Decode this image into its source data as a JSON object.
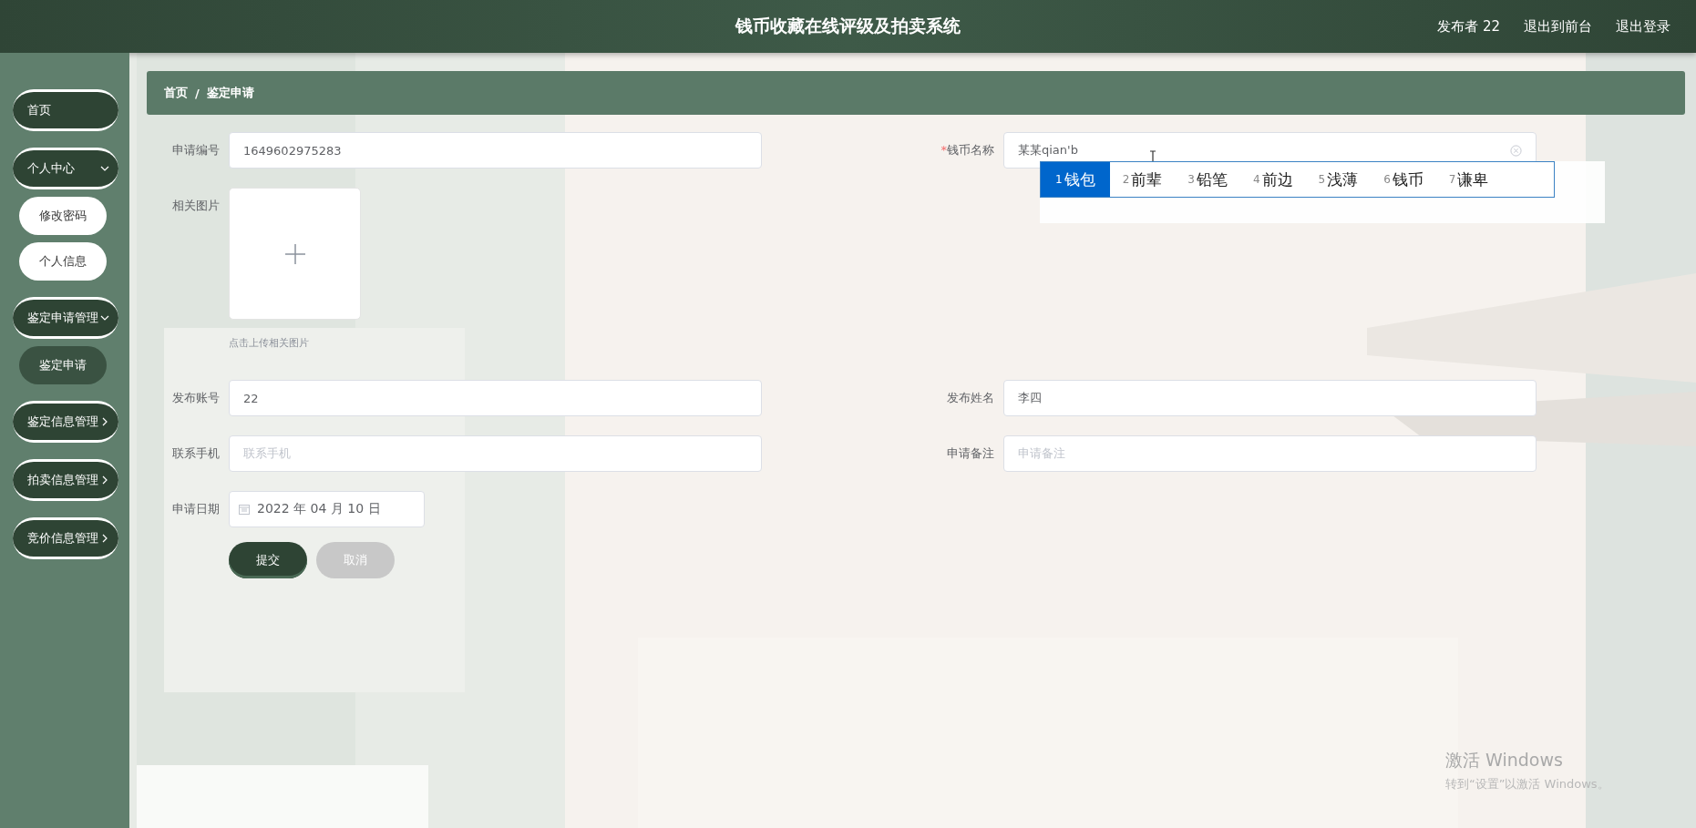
{
  "header": {
    "title": "钱币收藏在线评级及拍卖系统",
    "links": [
      "发布者 22",
      "退出到前台",
      "退出登录"
    ]
  },
  "sidebar": {
    "items": [
      {
        "label": "首页",
        "kind": "link"
      },
      {
        "label": "个人中心",
        "kind": "group",
        "expanded": true,
        "children": [
          {
            "label": "修改密码",
            "selected": false
          },
          {
            "label": "个人信息",
            "selected": false
          }
        ]
      },
      {
        "label": "鉴定申请管理",
        "kind": "group",
        "expanded": true,
        "children": [
          {
            "label": "鉴定申请",
            "selected": true
          }
        ]
      },
      {
        "label": "鉴定信息管理",
        "kind": "group",
        "expanded": false
      },
      {
        "label": "拍卖信息管理",
        "kind": "group",
        "expanded": false
      },
      {
        "label": "竞价信息管理",
        "kind": "group",
        "expanded": false
      }
    ]
  },
  "breadcrumb": {
    "items": [
      "首页",
      "鉴定申请"
    ],
    "separator": "/"
  },
  "form": {
    "rows": [
      [
        {
          "kind": "text",
          "label": "申请编号",
          "value": "1649602975283"
        },
        {
          "kind": "text",
          "label": "钱币名称",
          "required_mark": "*",
          "value": "某某qian'b",
          "clearable": true,
          "ime": true
        }
      ],
      [
        {
          "kind": "upload",
          "label": "相关图片",
          "hint": "点击上传相关图片"
        }
      ],
      [
        {
          "kind": "text",
          "label": "发布账号",
          "value": "22"
        },
        {
          "kind": "text",
          "label": "发布姓名",
          "value": "李四"
        }
      ],
      [
        {
          "kind": "text",
          "label": "联系手机",
          "placeholder": "联系手机"
        },
        {
          "kind": "text",
          "label": "申请备注",
          "placeholder": "申请备注"
        }
      ],
      [
        {
          "kind": "date",
          "label": "申请日期",
          "value": "2022 年 04 月 10 日"
        }
      ]
    ],
    "buttons": [
      {
        "label": "提交",
        "kind": "primary"
      },
      {
        "label": "取消",
        "kind": "secondary"
      }
    ]
  },
  "ime_popup": {
    "candidates": [
      {
        "number": "1",
        "word": "钱包",
        "selected": true
      },
      {
        "number": "2",
        "word": "前辈",
        "selected": false
      },
      {
        "number": "3",
        "word": "铅笔",
        "selected": false
      },
      {
        "number": "4",
        "word": "前边",
        "selected": false
      },
      {
        "number": "5",
        "word": "浅薄",
        "selected": false
      },
      {
        "number": "6",
        "word": "钱币",
        "selected": false
      },
      {
        "number": "7",
        "word": "谦卑",
        "selected": false
      }
    ]
  },
  "system_notice": {
    "title": "激活 Windows",
    "message": "转到“设置”以激活 Windows。"
  }
}
